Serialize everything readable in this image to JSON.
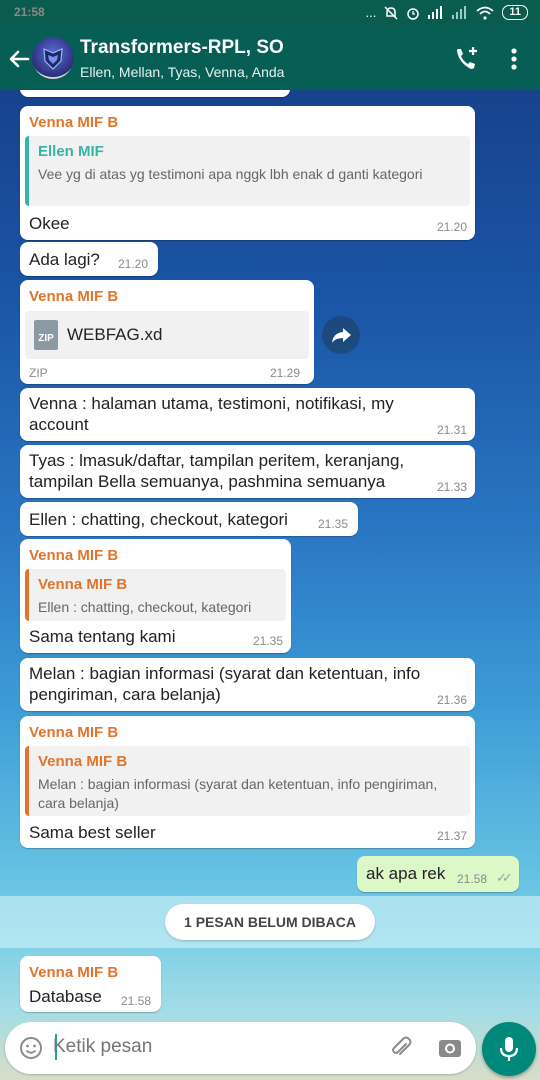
{
  "status_bar": {
    "time": "21:58",
    "signal_text": "...",
    "battery": "11"
  },
  "app_bar": {
    "title": "Transformers-RPL, SO",
    "subtitle": "Ellen, Mellan, Tyas, Venna, Anda",
    "icons": [
      "back-arrow-icon",
      "group-avatar",
      "add-call-icon",
      "more-vert-icon"
    ]
  },
  "messages": [
    {
      "sender": "Venna MIF B",
      "quote_sender": "Ellen MIF",
      "quote_text": "Vee yg di atas yg testimoni apa nggk lbh enak d ganti kategori",
      "text": "Okee",
      "time": "21.20"
    },
    {
      "text": "Ada lagi?",
      "time": "21.20"
    },
    {
      "sender": "Venna MIF B",
      "file_name": "WEBFAG.xd",
      "file_icon": "ZIP",
      "file_type": "ZIP",
      "time": "21.29"
    },
    {
      "text": "Venna : halaman utama, testimoni, notifikasi, my account",
      "time": "21.31"
    },
    {
      "text": "Tyas : lmasuk/daftar, tampilan peritem, keranjang, tampilan Bella semuanya, pashmina semuanya",
      "time": "21.33"
    },
    {
      "text": "Ellen : chatting, checkout, kategori",
      "time": "21.35"
    },
    {
      "sender": "Venna MIF B",
      "quote_sender": "Venna MIF B",
      "quote_text": "Ellen : chatting, checkout, kategori",
      "text": "Sama tentang kami",
      "time": "21.35"
    },
    {
      "text": "Melan : bagian informasi (syarat dan ketentuan, info pengiriman, cara belanja)",
      "time": "21.36"
    },
    {
      "sender": "Venna MIF B",
      "quote_sender": "Venna MIF B",
      "quote_text": "Melan : bagian informasi (syarat dan ketentuan, info pengiriman, cara belanja)",
      "text": "Sama best seller",
      "time": "21.37"
    },
    {
      "text": "ak apa rek",
      "time": "21.58",
      "outgoing": true,
      "read_ticks": "✓✓"
    },
    {
      "sender": "Venna MIF B",
      "text": "Database",
      "time": "21.58"
    }
  ],
  "unread_banner": "1 PESAN BELUM DIBACA",
  "composer": {
    "placeholder": "Ketik pesan"
  },
  "colors": {
    "header": "#075e54",
    "sender": "#e0752d",
    "quote_teal": "#35b5a8",
    "outgoing": "#dcf8c6",
    "mic": "#00897b"
  }
}
